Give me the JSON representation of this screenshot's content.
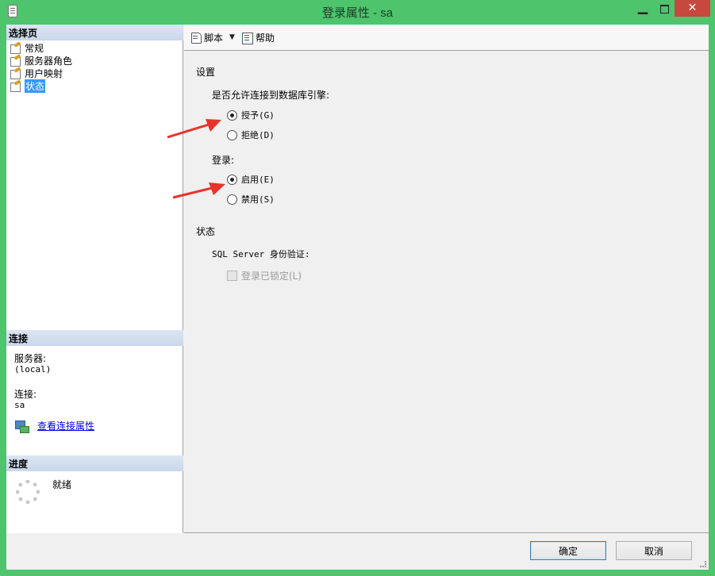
{
  "window": {
    "title": "登录属性 - sa",
    "minimize_glyph": "▁",
    "close_glyph": "✕"
  },
  "left": {
    "select_page_header": "选择页",
    "pages": [
      {
        "label": "常规",
        "icon": "page-settings-icon"
      },
      {
        "label": "服务器角色",
        "icon": "page-settings-icon"
      },
      {
        "label": "用户映射",
        "icon": "page-settings-icon"
      },
      {
        "label": "状态",
        "icon": "page-settings-icon",
        "selected": true
      }
    ],
    "connection_header": "连接",
    "server_label": "服务器:",
    "server_value": "(local)",
    "connection_label": "连接:",
    "connection_value": "sa",
    "view_connection_link": "查看连接属性",
    "progress_header": "进度",
    "progress_status": "就绪"
  },
  "toolbar": {
    "script_label": "脚本",
    "help_label": "帮助"
  },
  "content": {
    "settings_heading": "设置",
    "permission_label": "是否允许连接到数据库引擎:",
    "grant_option": "授予(G)",
    "deny_option": "拒绝(D)",
    "grant_selected": true,
    "login_label": "登录:",
    "enabled_option": "启用(E)",
    "disabled_option": "禁用(S)",
    "enabled_selected": true,
    "status_heading": "状态",
    "sql_auth_label": "SQL Server 身份验证:",
    "locked_checkbox": "登录已锁定(L)",
    "locked_checked": false
  },
  "buttons": {
    "ok": "确定",
    "cancel": "取消"
  },
  "colors": {
    "frame": "#4ec46d",
    "close_button": "#c7483e",
    "selection": "#3399ff",
    "annotation_arrow": "#e8332a"
  }
}
